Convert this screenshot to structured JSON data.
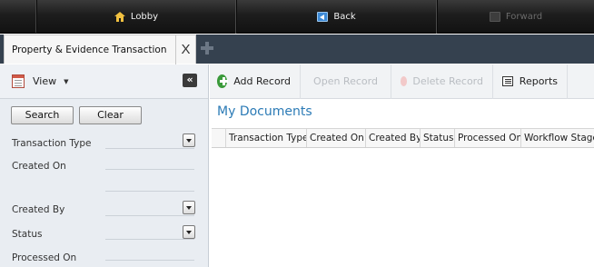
{
  "nav": {
    "lobby_label": "Lobby",
    "back_label": "Back",
    "forward_label": "Forward"
  },
  "tabs": [
    {
      "label": "Property & Evidence Transaction",
      "close": "X"
    }
  ],
  "sidebar": {
    "view_label": "View",
    "collapse_glyph": "«",
    "search_label": "Search",
    "clear_label": "Clear",
    "fields": [
      {
        "label": "Transaction Type"
      },
      {
        "label": "Created On"
      },
      {
        "label": "Created By"
      },
      {
        "label": "Status"
      },
      {
        "label": "Processed On"
      }
    ]
  },
  "toolbar": {
    "add_label": "Add Record",
    "open_label": "Open Record",
    "delete_label": "Delete Record",
    "reports_label": "Reports"
  },
  "main": {
    "title": "My Documents",
    "columns": [
      "Transaction Type",
      "Created On",
      "Created By",
      "Status",
      "Processed On",
      "Workflow Stage"
    ]
  },
  "colors": {
    "accent": "#2c7bb6",
    "nav_bg": "#1d1d1d",
    "tabstrip_bg": "#35414f",
    "add_icon": "#3a9a3a"
  }
}
